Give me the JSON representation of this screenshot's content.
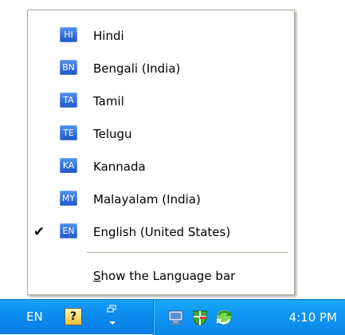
{
  "language_menu": {
    "items": [
      {
        "code": "HI",
        "label": "Hindi",
        "checked": false,
        "check_mark": ""
      },
      {
        "code": "BN",
        "label": "Bengali (India)",
        "checked": false,
        "check_mark": ""
      },
      {
        "code": "TA",
        "label": "Tamil",
        "checked": false,
        "check_mark": ""
      },
      {
        "code": "TE",
        "label": "Telugu",
        "checked": false,
        "check_mark": ""
      },
      {
        "code": "KA",
        "label": "Kannada",
        "checked": false,
        "check_mark": ""
      },
      {
        "code": "MY",
        "label": "Malayalam (India)",
        "checked": false,
        "check_mark": ""
      },
      {
        "code": "EN",
        "label": "English (United States)",
        "checked": true,
        "check_mark": "✔"
      }
    ],
    "show_language_bar": {
      "access_key": "S",
      "label_rest": "how the Language bar"
    }
  },
  "taskbar": {
    "language_code": "EN",
    "help_icon_text": "?",
    "clock": "4:10 PM",
    "icons": [
      "help-icon",
      "options-icon",
      "network-icon",
      "security-shield-icon",
      "sync-icon"
    ]
  },
  "colors": {
    "menu_border": "#aca899",
    "language_icon": "#2d6bd4",
    "taskbar_blue": "#0c8cf0",
    "notify_area_blue": "#0f95f3"
  }
}
